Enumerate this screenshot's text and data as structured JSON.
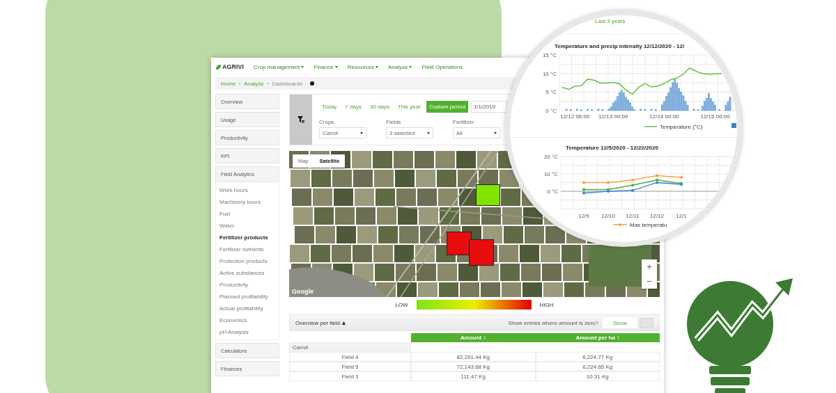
{
  "header": {
    "logo": "AGRIVI",
    "nav": [
      {
        "label": "Crop management",
        "dropdown": true
      },
      {
        "label": "Finance",
        "dropdown": true
      },
      {
        "label": "Resources",
        "dropdown": true
      },
      {
        "label": "Analyze",
        "dropdown": true
      },
      {
        "label": "Field Operations",
        "dropdown": false
      }
    ]
  },
  "breadcrumb": [
    {
      "label": "Home",
      "link": true
    },
    {
      "label": "Analyze",
      "link": true
    },
    {
      "label": "Dashboards",
      "link": false
    }
  ],
  "sidebar": {
    "items": [
      {
        "label": "Overview"
      },
      {
        "label": "Usage"
      },
      {
        "label": "Productivity"
      },
      {
        "label": "KPI"
      },
      {
        "label": "Field Analytics",
        "children": [
          {
            "label": "Work hours",
            "selected": false
          },
          {
            "label": "Machinery hours",
            "selected": false
          },
          {
            "label": "Fuel",
            "selected": false
          },
          {
            "label": "Water",
            "selected": false
          },
          {
            "label": "Fertilizer products",
            "selected": true
          },
          {
            "label": "Fertilizer nutrients",
            "selected": false
          },
          {
            "label": "Protection products",
            "selected": false
          },
          {
            "label": "Active substances",
            "selected": false
          },
          {
            "label": "Productivity",
            "selected": false
          },
          {
            "label": "Planned profitability",
            "selected": false
          },
          {
            "label": "Actual profitability",
            "selected": false
          },
          {
            "label": "Economics",
            "selected": false
          },
          {
            "label": "pH Analysis",
            "selected": false
          }
        ]
      },
      {
        "label": "Calculators"
      },
      {
        "label": "Finances"
      }
    ]
  },
  "filters": {
    "periods": [
      {
        "label": "Today",
        "selected": false
      },
      {
        "label": "7 days",
        "selected": false
      },
      {
        "label": "30 days",
        "selected": false
      },
      {
        "label": "This year",
        "selected": false
      },
      {
        "label": "Custom period",
        "selected": true
      }
    ],
    "date_from": "1/1/2019",
    "selects": [
      {
        "label": "Crops",
        "value": "Carrot"
      },
      {
        "label": "Fields",
        "value": "3 selected"
      },
      {
        "label": "Fertilizer",
        "value": "All"
      }
    ]
  },
  "map": {
    "types": [
      {
        "label": "Map",
        "selected": false
      },
      {
        "label": "Satellite",
        "selected": true
      }
    ],
    "fields": [
      {
        "color": "#80e400"
      },
      {
        "color": "#e80c0c"
      },
      {
        "color": "#e80c0c"
      }
    ],
    "zoom_in": "+",
    "zoom_out": "−",
    "provider": "Google"
  },
  "legend": {
    "low": "LOW",
    "high": "HIGH"
  },
  "overview": {
    "title": "Overview per field",
    "zero_prompt": "Show entries where amount is zero?",
    "zero_button": "Show",
    "columns": [
      "Amount ↕",
      "Amount per ha ↕"
    ],
    "groups": [
      {
        "name": "Carrot",
        "rows": [
          {
            "field": "Field 4",
            "amount": "82,291.44 Kg",
            "per_ha": "6,224.77 Kg"
          },
          {
            "field": "Field 5",
            "amount": "72,143.68 Kg",
            "per_ha": "6,224.65 Kg"
          },
          {
            "field": "Field 3",
            "amount": "111.47 Kg",
            "per_ha": "10.31 Kg"
          }
        ]
      }
    ]
  },
  "magnifier": {
    "caption": "Last 3 years",
    "charts": [
      {
        "chart_data": {
          "type": "line",
          "title": "Temperature and precip intensity 12/12/2020 - 12/",
          "categories": [
            null,
            null,
            "12/12 06:00",
            null,
            null,
            null,
            null,
            null,
            "12/13 00:00",
            null,
            null,
            null,
            null,
            null,
            null,
            null,
            "12/14 00:00",
            null,
            null,
            null,
            null,
            null,
            null,
            null,
            "12/15 00:00",
            null
          ],
          "series": [
            {
              "name": "Temperature (°C)",
              "color": "#6cc24a",
              "values": [
                6.3,
                5.7,
                6.6,
                6.7,
                8.5,
                8.2,
                7.4,
                7.4,
                7.6,
                7.2,
                5.5,
                4.4,
                6.3,
                7.3,
                6.4,
                6.6,
                7.3,
                8.3,
                8.8,
                9.8,
                11.5,
                10.6,
                10.0,
                9.8,
                9.9,
                10.0
              ]
            }
          ],
          "ylim": [
            0,
            15
          ],
          "grid": true,
          "yticks": [
            {
              "value": 0,
              "label": "0 °C"
            },
            {
              "value": 5,
              "label": "5 °C"
            },
            {
              "value": 10,
              "label": "10 °C"
            },
            {
              "value": 15,
              "label": "15 °C"
            }
          ]
        }
      },
      {
        "chart_data": {
          "type": "line",
          "title": "Temperature 12/5/2020 - 12/22/2020",
          "categories": [
            "12/9",
            "12/10",
            "12/11",
            "12/12",
            "12/1"
          ],
          "series": [
            {
              "name": "Max temperatu",
              "color": "#f5a33c",
              "values": [
                5,
                5,
                6.5,
                9,
                8
              ]
            },
            {
              "color": "#4cae3c",
              "values": [
                1,
                1,
                3.5,
                6.5,
                4.5
              ]
            },
            {
              "color": "#3c84d4",
              "values": [
                -1,
                0,
                0.5,
                5,
                4
              ]
            }
          ],
          "ylim": [
            -10,
            20
          ],
          "grid": true,
          "yticks": [
            {
              "value": 0,
              "label": "0 °C"
            },
            {
              "value": 10,
              "label": "10 °C"
            },
            {
              "value": 20,
              "label": "20 °C"
            }
          ]
        }
      }
    ]
  }
}
